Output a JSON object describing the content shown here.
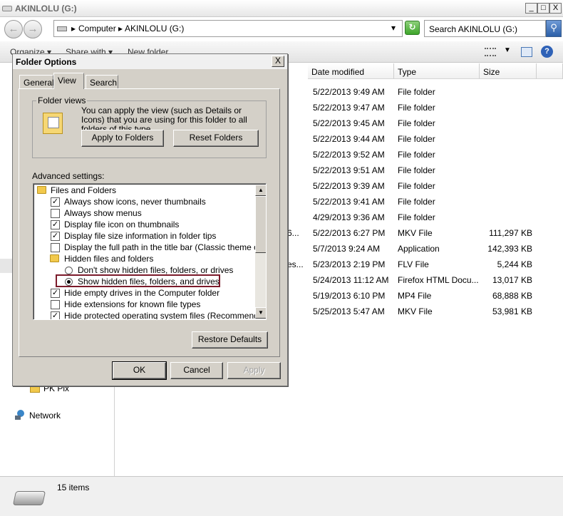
{
  "window": {
    "title": "AKINLOLU (G:)",
    "controls": {
      "minimize": "_",
      "maximize": "□",
      "close": "X"
    }
  },
  "address": {
    "crumbs": [
      "Computer",
      "AKINLOLU (G:)"
    ],
    "search_placeholder": "Search AKINLOLU (G:)"
  },
  "command_bar": {
    "organize": "Organize ▾",
    "share_with": "Share with ▾",
    "new_folder": "New folder"
  },
  "nav_pane": {
    "items": [
      {
        "label": "PK Pix",
        "icon": "folder-icon"
      },
      {
        "label": "Network",
        "icon": "network-icon"
      }
    ]
  },
  "file_list": {
    "columns": [
      "Date modified",
      "Type",
      "Size"
    ],
    "rows": [
      {
        "name_tail": "",
        "date": "5/22/2013 9:49 AM",
        "type": "File folder",
        "size": ""
      },
      {
        "name_tail": "",
        "date": "5/22/2013 9:47 AM",
        "type": "File folder",
        "size": ""
      },
      {
        "name_tail": "",
        "date": "5/22/2013 9:45 AM",
        "type": "File folder",
        "size": ""
      },
      {
        "name_tail": "",
        "date": "5/22/2013 9:44 AM",
        "type": "File folder",
        "size": ""
      },
      {
        "name_tail": "",
        "date": "5/22/2013 9:52 AM",
        "type": "File folder",
        "size": ""
      },
      {
        "name_tail": "",
        "date": "5/22/2013 9:51 AM",
        "type": "File folder",
        "size": ""
      },
      {
        "name_tail": "",
        "date": "5/22/2013 9:39 AM",
        "type": "File folder",
        "size": ""
      },
      {
        "name_tail": "",
        "date": "5/22/2013 9:41 AM",
        "type": "File folder",
        "size": ""
      },
      {
        "name_tail": "",
        "date": "4/29/2013 9:36 AM",
        "type": "File folder",
        "size": ""
      },
      {
        "name_tail": "6...",
        "date": "5/22/2013 6:27 PM",
        "type": "MKV File",
        "size": "111,297 KB"
      },
      {
        "name_tail": "",
        "date": "5/7/2013 9:24 AM",
        "type": "Application",
        "size": "142,393 KB"
      },
      {
        "name_tail": "es...",
        "date": "5/23/2013 2:19 PM",
        "type": "FLV File",
        "size": "5,244 KB"
      },
      {
        "name_tail": "",
        "date": "5/24/2013 11:12 AM",
        "type": "Firefox HTML Docu...",
        "size": "13,017 KB"
      },
      {
        "name_tail": "",
        "date": "5/19/2013 6:10 PM",
        "type": "MP4 File",
        "size": "68,888 KB"
      },
      {
        "name_tail": "",
        "date": "5/25/2013 5:47 AM",
        "type": "MKV File",
        "size": "53,981 KB"
      }
    ]
  },
  "status": {
    "item_count": "15 items"
  },
  "dialog": {
    "title": "Folder Options",
    "close": "X",
    "tabs": [
      "General",
      "View",
      "Search"
    ],
    "active_tab": "View",
    "folder_views": {
      "legend": "Folder views",
      "description": "You can apply the view (such as Details or Icons) that you are using for this folder to all folders of this type.",
      "apply_button": "Apply to Folders",
      "reset_button": "Reset Folders"
    },
    "advanced_label": "Advanced settings:",
    "advanced_items": [
      {
        "kind": "folder",
        "label": "Files and Folders"
      },
      {
        "kind": "checkbox",
        "checked": true,
        "label": "Always show icons, never thumbnails"
      },
      {
        "kind": "checkbox",
        "checked": false,
        "label": "Always show menus"
      },
      {
        "kind": "checkbox",
        "checked": true,
        "label": "Display file icon on thumbnails"
      },
      {
        "kind": "checkbox",
        "checked": true,
        "label": "Display file size information in folder tips"
      },
      {
        "kind": "checkbox",
        "checked": false,
        "label": "Display the full path in the title bar (Classic theme only)"
      },
      {
        "kind": "folder",
        "label": "Hidden files and folders"
      },
      {
        "kind": "radio",
        "checked": false,
        "label": "Don't show hidden files, folders, or drives"
      },
      {
        "kind": "radio",
        "checked": true,
        "label": "Show hidden files, folders, and drives"
      },
      {
        "kind": "checkbox",
        "checked": true,
        "label": "Hide empty drives in the Computer folder"
      },
      {
        "kind": "checkbox",
        "checked": false,
        "label": "Hide extensions for known file types"
      },
      {
        "kind": "checkbox",
        "checked": true,
        "label": "Hide protected operating system files (Recommended)"
      }
    ],
    "restore_defaults": "Restore Defaults",
    "ok": "OK",
    "cancel": "Cancel",
    "apply": "Apply"
  }
}
